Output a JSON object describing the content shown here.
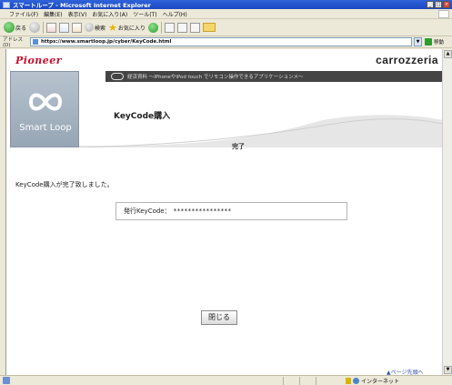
{
  "window": {
    "title": "スマートループ - Microsoft Internet Explorer",
    "minimize": "_",
    "maximize": "□",
    "close": "×"
  },
  "menu": [
    "ファイル(F)",
    "編集(E)",
    "表示(V)",
    "お気に入り(A)",
    "ツール(T)",
    "ヘルプ(H)"
  ],
  "toolbar": {
    "back_label": "戻る",
    "search_label": "検索",
    "favorites_label": "お気に入り"
  },
  "address": {
    "label": "アドレス(D)",
    "url": "https://www.smartloop.jp/cyber/KeyCode.html",
    "go_label": "移動"
  },
  "page": {
    "pioneer_logo": "Pioneer",
    "brand_logo": "carrozzeria",
    "smartloop_logo": "Smart Loop",
    "strip_text": "経済資料 〜iPhoneやiPod touch でリモコン操作できるアプリケーションメ〜",
    "title": "KeyCode購入",
    "step": "完了",
    "message": "KeyCode購入が完了致しました。",
    "keycode_label": "発行KeyCode：",
    "keycode_value": "****************",
    "close_button": "閉じる",
    "page_top": "▲ページ先頭へ"
  },
  "status": {
    "zone_label": "インターネット"
  },
  "colors": {
    "pioneer_red": "#c8102e",
    "titlebar_blue": "#1b47c2",
    "strip_dark": "#444444"
  }
}
